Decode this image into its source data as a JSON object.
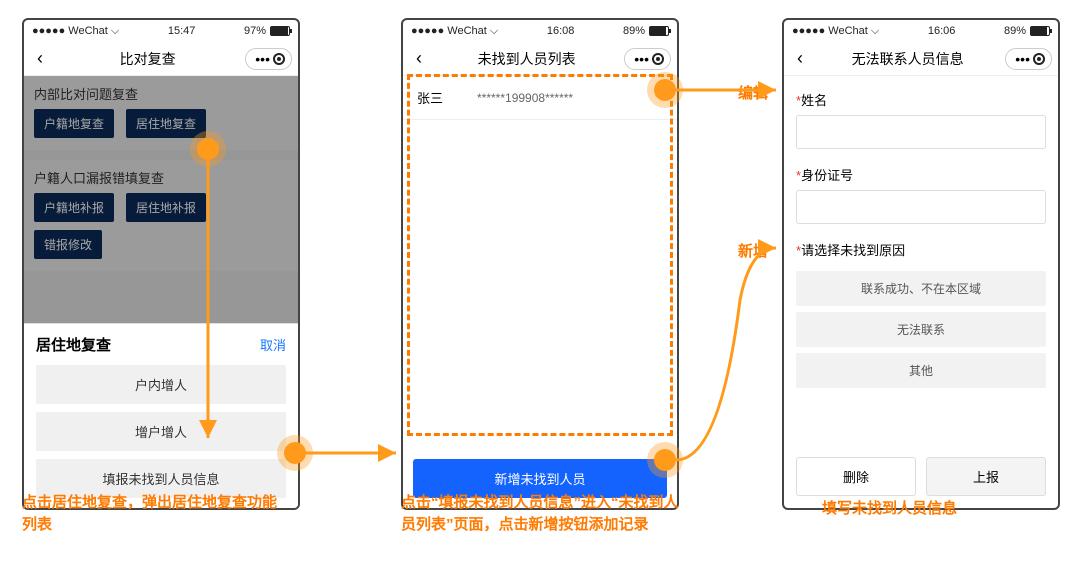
{
  "colors": {
    "accent": "#ff7a00",
    "primary": "#1463ff",
    "navbtn": "#0b2b5a"
  },
  "phone1": {
    "status": {
      "carrier": "●●●●● WeChat ⌵",
      "time": "15:47",
      "battery_pct": "97%"
    },
    "title": "比对复查",
    "section1": {
      "heading": "内部比对问题复查",
      "btn_a": "户籍地复查",
      "btn_b": "居住地复查"
    },
    "section2": {
      "heading": "户籍人口漏报错填复查",
      "btn_a": "户籍地补报",
      "btn_b": "居住地补报",
      "btn_c": "错报修改"
    },
    "sheet": {
      "title": "居住地复查",
      "cancel": "取消",
      "items": [
        "户内增人",
        "增户增人",
        "填报未找到人员信息"
      ]
    }
  },
  "phone2": {
    "status": {
      "carrier": "●●●●● WeChat ⌵",
      "time": "16:08",
      "battery_pct": "89%"
    },
    "title": "未找到人员列表",
    "row": {
      "name": "张三",
      "id": "******199908******"
    },
    "primary_btn": "新增未找到人员"
  },
  "phone3": {
    "status": {
      "carrier": "●●●●● WeChat ⌵",
      "time": "16:06",
      "battery_pct": "89%"
    },
    "title": "无法联系人员信息",
    "labels": {
      "name": "姓名",
      "id": "身份证号",
      "reason": "请选择未找到原因"
    },
    "options": [
      "联系成功、不在本区域",
      "无法联系",
      "其他"
    ],
    "btn_delete": "删除",
    "btn_submit": "上报"
  },
  "annotations": {
    "edit": "编辑",
    "add": "新增",
    "cap1": "点击居住地复查，弹出居住地复查功能列表",
    "cap2": "点击“填报未找到人员信息”进入“未找到人员列表”页面，点击新增按钮添加记录",
    "cap3": "填写未找到人员信息"
  }
}
